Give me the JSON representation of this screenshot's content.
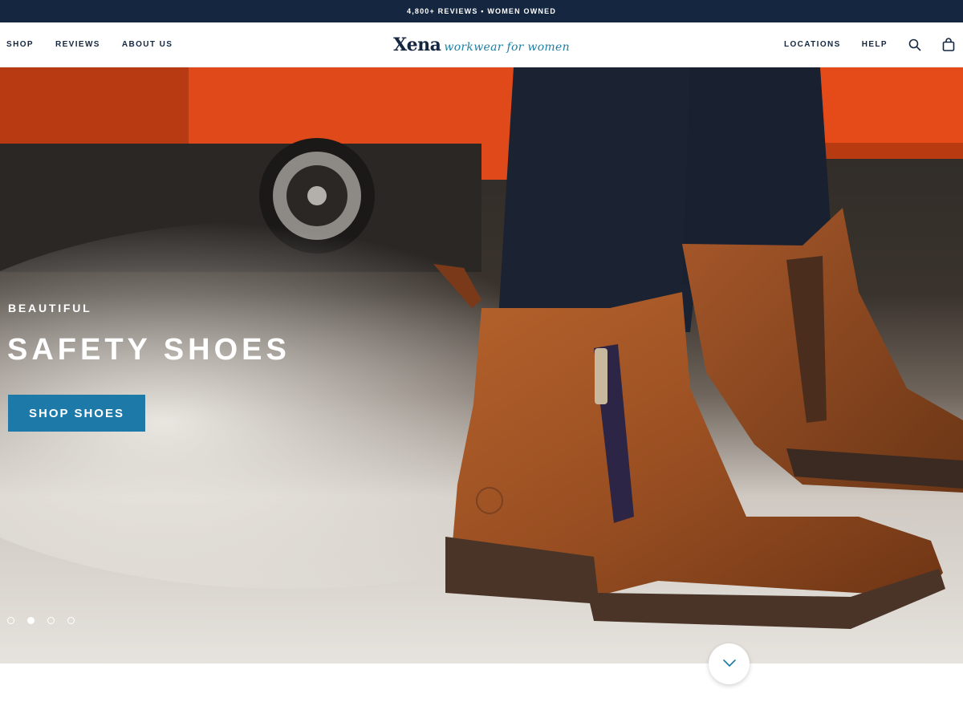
{
  "announcement": {
    "text": "4,800+ REVIEWS • WOMEN OWNED"
  },
  "nav": {
    "left": [
      {
        "label": "SHOP"
      },
      {
        "label": "REVIEWS"
      },
      {
        "label": "ABOUT US"
      }
    ],
    "right": [
      {
        "label": "LOCATIONS"
      },
      {
        "label": "HELP"
      }
    ],
    "icons": {
      "search": "search-icon",
      "bag": "shopping-bag-icon"
    }
  },
  "logo": {
    "word": "Xena",
    "tagline": "workwear for women"
  },
  "hero": {
    "eyebrow": "BEAUTIFUL",
    "headline": "SAFETY SHOES",
    "cta": "SHOP SHOES",
    "slides": {
      "total": 4,
      "active": 2
    },
    "scroll_icon": "chevron-down-icon"
  },
  "colors": {
    "announcement_bg": "#142640",
    "brand_navy": "#142640",
    "accent_blue": "#1d7aa8",
    "tagline_teal": "#1d7fa3"
  }
}
